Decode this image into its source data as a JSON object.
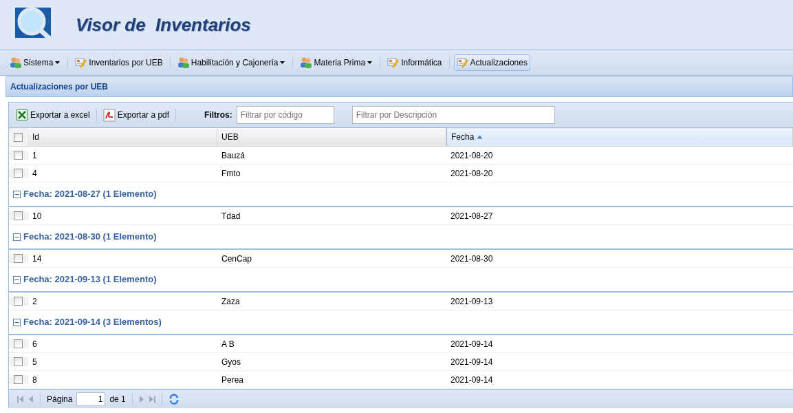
{
  "app": {
    "title": "Visor de  Inventarios"
  },
  "menu": [
    {
      "label": "Sistema",
      "kind": "menu",
      "selected": false
    },
    {
      "label": "Inventarios por UEB",
      "kind": "link",
      "selected": false
    },
    {
      "label": "Habilitación y Cajonería",
      "kind": "menu",
      "selected": false
    },
    {
      "label": "Materia Prima",
      "kind": "menu",
      "selected": false
    },
    {
      "label": "Informática",
      "kind": "link",
      "selected": false
    },
    {
      "label": "Actualizaciones",
      "kind": "link",
      "selected": true
    }
  ],
  "panel": {
    "title": "Actualizaciones por UEB"
  },
  "toolbar": {
    "buttons": [
      {
        "label": "Exportar a excel",
        "kind": "excel"
      },
      {
        "label": "Exportar a pdf",
        "kind": "pdf"
      }
    ],
    "filters_label": "Filtros:",
    "filters": [
      {
        "placeholder": "Filtrar por código"
      },
      {
        "placeholder": "Filtrar por Descripción"
      }
    ]
  },
  "table": {
    "all_checked": false,
    "columns": [
      {
        "label": "Id",
        "sorted": false
      },
      {
        "label": "UEB",
        "sorted": false
      },
      {
        "label": "Fecha",
        "sorted": true
      }
    ],
    "rows": [
      {
        "kind": "row",
        "id": "1",
        "ueb": "Bauzá",
        "fecha": "2021-08-20",
        "checked": false
      },
      {
        "kind": "row",
        "id": "4",
        "ueb": "Fmto",
        "fecha": "2021-08-20",
        "checked": false
      },
      {
        "kind": "group",
        "label": "Fecha: 2021-08-27 (1 Elemento)",
        "expanded": true
      },
      {
        "kind": "row",
        "id": "10",
        "ueb": "Tdad",
        "fecha": "2021-08-27",
        "checked": false
      },
      {
        "kind": "group",
        "label": "Fecha: 2021-08-30 (1 Elemento)",
        "expanded": true
      },
      {
        "kind": "row",
        "id": "14",
        "ueb": "CenCap",
        "fecha": "2021-08-30",
        "checked": false
      },
      {
        "kind": "group",
        "label": "Fecha: 2021-09-13 (1 Elemento)",
        "expanded": true
      },
      {
        "kind": "row",
        "id": "2",
        "ueb": "Zaza",
        "fecha": "2021-09-13",
        "checked": false
      },
      {
        "kind": "group",
        "label": "Fecha: 2021-09-14 (3 Elementos)",
        "expanded": true
      },
      {
        "kind": "row",
        "id": "6",
        "ueb": "A B",
        "fecha": "2021-09-14",
        "checked": false
      },
      {
        "kind": "row",
        "id": "5",
        "ueb": "Gyos",
        "fecha": "2021-09-14",
        "checked": false
      },
      {
        "kind": "row",
        "id": "8",
        "ueb": "Perea",
        "fecha": "2021-09-14",
        "checked": false
      }
    ]
  },
  "pager": {
    "page_label": "Página",
    "page": "1",
    "of_label": "de 1"
  }
}
